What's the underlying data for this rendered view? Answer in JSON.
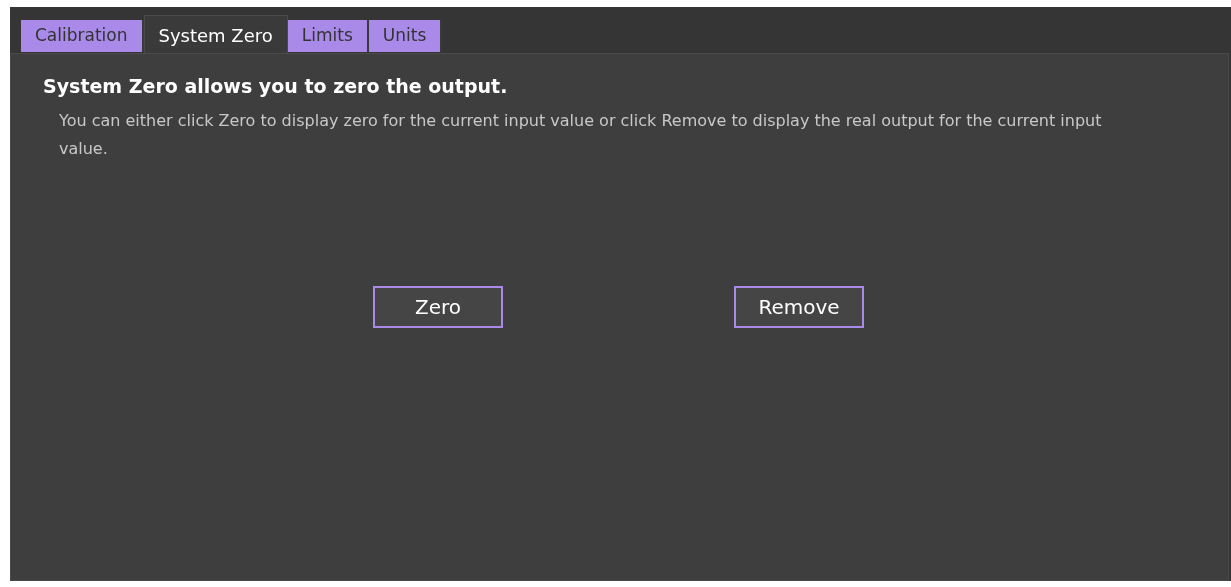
{
  "tabs": [
    {
      "label": "Calibration",
      "selected": false
    },
    {
      "label": "System Zero",
      "selected": true
    },
    {
      "label": "Limits",
      "selected": false
    },
    {
      "label": "Units",
      "selected": false
    }
  ],
  "panel": {
    "heading": "System Zero allows you to zero the output.",
    "description": "You can either click Zero to display zero for the current input value or click Remove to display the real output for the current input value."
  },
  "buttons": [
    "Zero",
    "Remove"
  ]
}
